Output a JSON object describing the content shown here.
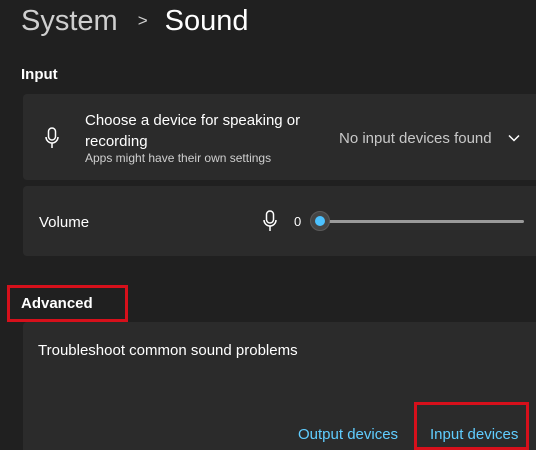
{
  "breadcrumb": {
    "parent": "System",
    "separator": ">",
    "current": "Sound"
  },
  "input_section": {
    "title": "Input",
    "device_card": {
      "icon": "microphone-icon",
      "title": "Choose a device for speaking or recording",
      "subtitle": "Apps might have their own settings",
      "selected_device": "No input devices found",
      "chevron_icon": "chevron-down-icon"
    },
    "volume_card": {
      "label": "Volume",
      "icon": "microphone-icon",
      "value": "0",
      "level_percent": 0
    }
  },
  "advanced_section": {
    "title": "Advanced",
    "troubleshoot_card": {
      "title": "Troubleshoot common sound problems",
      "links": {
        "output": "Output devices",
        "input": "Input devices"
      }
    }
  },
  "colors": {
    "background": "#202020",
    "card": "#2b2b2b",
    "accent": "#4cc2ff",
    "link": "#60cdff",
    "highlight_box": "#d6101b"
  }
}
